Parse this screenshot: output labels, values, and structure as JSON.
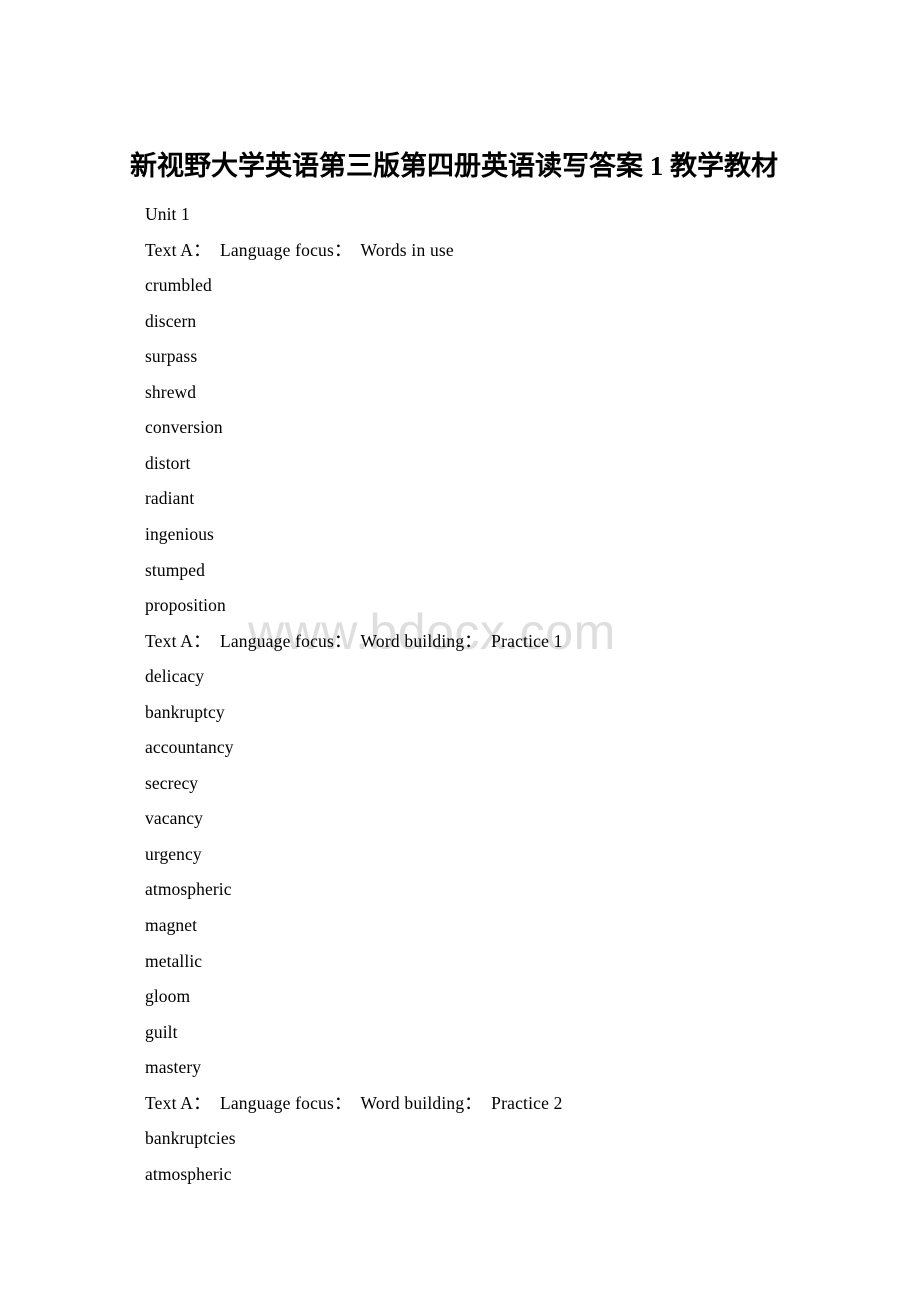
{
  "document": {
    "title": "新视野大学英语第三版第四册英语读写答案 1 教学教材",
    "watermark": "www.bdocx.com",
    "lines": [
      {
        "text": "Unit 1",
        "kind": "body"
      },
      {
        "text": "Text A：  Language focus：  Words in use",
        "kind": "heading"
      },
      {
        "text": "crumbled",
        "kind": "body"
      },
      {
        "text": "discern",
        "kind": "body"
      },
      {
        "text": "surpass",
        "kind": "body"
      },
      {
        "text": "shrewd",
        "kind": "body"
      },
      {
        "text": "conversion",
        "kind": "body"
      },
      {
        "text": "distort",
        "kind": "body"
      },
      {
        "text": "radiant",
        "kind": "body"
      },
      {
        "text": "ingenious",
        "kind": "body"
      },
      {
        "text": "stumped",
        "kind": "body"
      },
      {
        "text": "proposition",
        "kind": "body"
      },
      {
        "text": "Text A：  Language focus：  Word building：  Practice 1",
        "kind": "heading"
      },
      {
        "text": "delicacy",
        "kind": "body"
      },
      {
        "text": "bankruptcy",
        "kind": "body"
      },
      {
        "text": "accountancy",
        "kind": "body"
      },
      {
        "text": "secrecy",
        "kind": "body"
      },
      {
        "text": "vacancy",
        "kind": "body"
      },
      {
        "text": "urgency",
        "kind": "body"
      },
      {
        "text": "atmospheric",
        "kind": "body"
      },
      {
        "text": "magnet",
        "kind": "body"
      },
      {
        "text": "metallic",
        "kind": "body"
      },
      {
        "text": "gloom",
        "kind": "body"
      },
      {
        "text": "guilt",
        "kind": "body"
      },
      {
        "text": "mastery",
        "kind": "body"
      },
      {
        "text": "Text A：  Language focus：  Word building：  Practice 2",
        "kind": "heading"
      },
      {
        "text": "bankruptcies",
        "kind": "body"
      },
      {
        "text": "atmospheric",
        "kind": "body"
      }
    ]
  }
}
